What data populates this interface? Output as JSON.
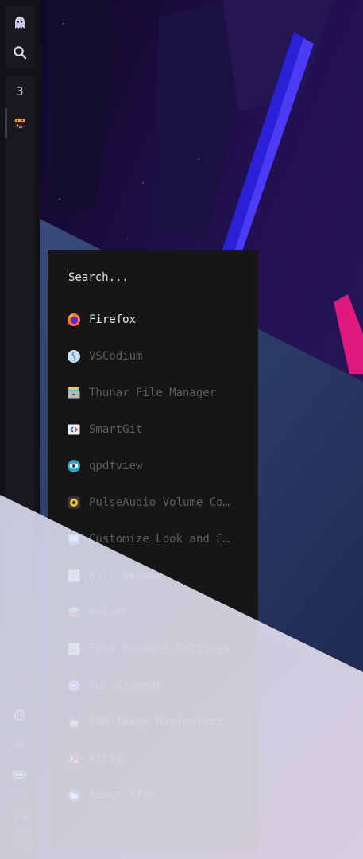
{
  "panel": {
    "top_icons": [
      "ghost-icon",
      "search-icon"
    ],
    "workspace": {
      "number": "3",
      "app_icon": "terminal-app-icon"
    },
    "tray_icons": [
      "network-icon",
      "volume-icon",
      "battery-icon"
    ],
    "clock": {
      "hour": "19",
      "minute": "42"
    }
  },
  "launcher": {
    "search_placeholder": "Search...",
    "apps": [
      {
        "label": "Firefox",
        "icon": "firefox-icon",
        "selected": true
      },
      {
        "label": "VSCodium",
        "icon": "vscodium-icon"
      },
      {
        "label": "Thunar File Manager",
        "icon": "file-manager-icon"
      },
      {
        "label": "SmartGit",
        "icon": "smartgit-icon"
      },
      {
        "label": "qpdfview",
        "icon": "eye-icon"
      },
      {
        "label": "PulseAudio Volume Cont…",
        "icon": "speaker-icon"
      },
      {
        "label": "Customize Look and Feel",
        "icon": "appearance-icon"
      },
      {
        "label": "Bulk Rename",
        "icon": "file-manager-icon"
      },
      {
        "label": "PolyMC",
        "icon": "polymc-icon"
      },
      {
        "label": "File Manager Settings",
        "icon": "file-manager-icon"
      },
      {
        "label": "Tor Browser",
        "icon": "tor-icon"
      },
      {
        "label": "GNU Image Manipulation…",
        "icon": "gimp-icon"
      },
      {
        "label": "kitty",
        "icon": "terminal-icon"
      },
      {
        "label": "About Xfce",
        "icon": "xfce-icon"
      }
    ]
  },
  "colors": {
    "panel_bg": "#111116",
    "launcher_bg": "#161616",
    "selected_text": "#ececec",
    "muted_text": "#5d5d5d",
    "overlay_light": "#dfe3f5"
  }
}
